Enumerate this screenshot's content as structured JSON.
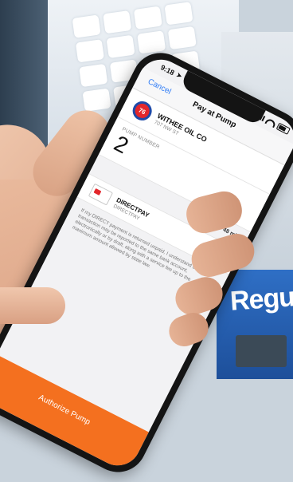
{
  "status": {
    "time": "9:18"
  },
  "nav": {
    "cancel_label": "Cancel",
    "title": "Pay at Pump"
  },
  "station": {
    "logo_text": "76",
    "name": "WITHEE OIL CO",
    "address": "707 NW ST"
  },
  "pump": {
    "label": "PUMP NUMBER",
    "number": "2"
  },
  "distance": "48 mi",
  "payment": {
    "name": "DIRECTPAY",
    "sub": "DIRECTPAY"
  },
  "disclaimer": "If my DIRECT payment is returned unpaid, I understand that the transaction may be reported to the same bank account, electronically or by draft, along with a service fee up to the maximum amount allowed by state law.",
  "authorize_label": "Authorize Pump",
  "background_sign": "Regu",
  "colors": {
    "accent": "#f4701f",
    "link": "#2f7cf6"
  }
}
